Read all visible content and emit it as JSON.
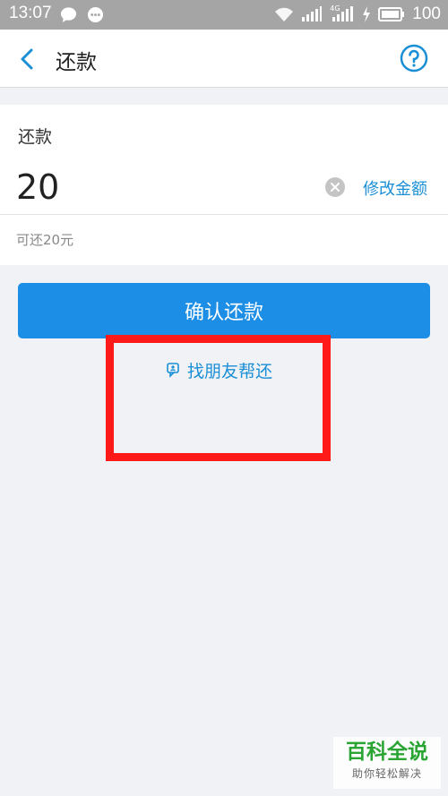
{
  "status_bar": {
    "time": "13:07",
    "network_label": "4G",
    "battery": "100"
  },
  "nav": {
    "title": "还款",
    "back_icon": "chevron-left-icon",
    "help_icon": "question-circle-icon"
  },
  "form": {
    "label": "还款",
    "amount_value": "20",
    "modify_label": "修改金额",
    "available_text": "可还20元"
  },
  "actions": {
    "confirm_label": "确认还款",
    "friend_label": "找朋友帮还"
  },
  "watermark": {
    "main": "百科全说",
    "sub": "助你轻松解决"
  },
  "colors": {
    "accent": "#1c8ee5",
    "link": "#1a8fd6",
    "annotation": "#ff1a1a",
    "background": "#f1f2f6"
  }
}
